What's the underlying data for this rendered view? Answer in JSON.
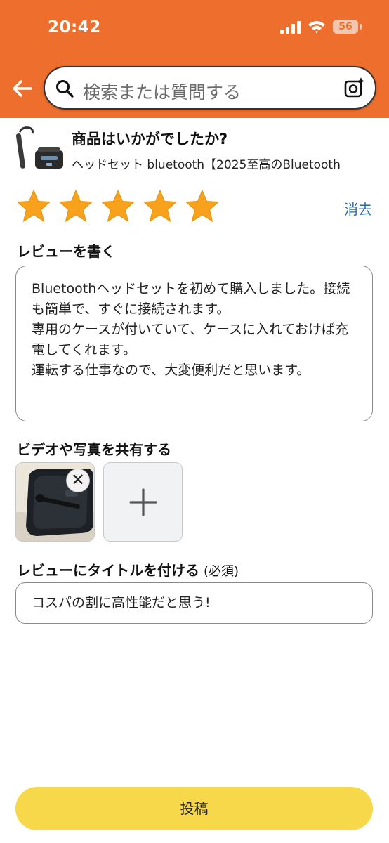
{
  "status_bar": {
    "time": "20:42",
    "battery": "56"
  },
  "search": {
    "placeholder": "検索または質問する"
  },
  "product": {
    "heading": "商品はいかがでしたか?",
    "name": "ヘッドセット bluetooth【2025至高のBluetooth"
  },
  "rating": {
    "stars": 5,
    "max": 5,
    "clear_label": "消去"
  },
  "review": {
    "label": "レビューを書く",
    "text": "Bluetoothヘッドセットを初めて購入しました。接続も簡単で、すぐに接続されます。\n専用のケースが付いていて、ケースに入れておけば充電してくれます。\n運転する仕事なので、大変便利だと思います。"
  },
  "media": {
    "label": "ビデオや写真を共有する",
    "remove_symbol": "✕"
  },
  "title_field": {
    "label": "レビューにタイトルを付ける",
    "required": "(必須)",
    "value": "コスパの割に高性能だと思う!"
  },
  "submit": {
    "label": "投稿"
  },
  "colors": {
    "header": "#ee6f2d",
    "star": "#f7a11c",
    "link": "#2f6aa6",
    "button": "#f6d84a"
  },
  "icons": [
    "back-arrow-icon",
    "search-icon",
    "camera-search-icon",
    "star-icon",
    "close-icon",
    "plus-icon"
  ]
}
